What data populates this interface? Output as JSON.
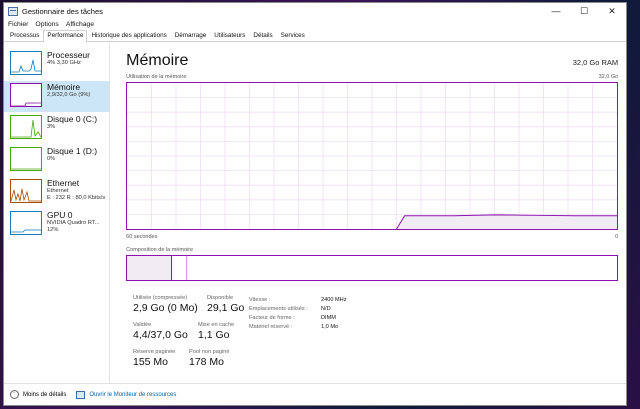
{
  "window": {
    "title": "Gestionnaire des tâches"
  },
  "menu": [
    "Fichier",
    "Options",
    "Affichage"
  ],
  "tabs": [
    "Processus",
    "Performance",
    "Historique des applications",
    "Démarrage",
    "Utilisateurs",
    "Détails",
    "Services"
  ],
  "active_tab": "Performance",
  "sidebar": [
    {
      "name": "Processeur",
      "line1": "4% 3,30 GHz",
      "line2": "",
      "line3": "",
      "color": "#117dbb",
      "icon": "cpu-graph-icon"
    },
    {
      "name": "Mémoire",
      "line1": "2,9/32,0 Go (9%)",
      "line2": "",
      "line3": "",
      "color": "#8b12ae",
      "icon": "memory-graph-icon"
    },
    {
      "name": "Disque 0 (C:)",
      "line1": "3%",
      "line2": "",
      "line3": "",
      "color": "#4da60c",
      "icon": "disk-graph-icon"
    },
    {
      "name": "Disque 1 (D:)",
      "line1": "0%",
      "line2": "",
      "line3": "",
      "color": "#4da60c",
      "icon": "disk-graph-icon"
    },
    {
      "name": "Ethernet",
      "line1": "Ethernet",
      "line2": "E : 232 R : 80,0 Kbits/s",
      "line3": "",
      "color": "#a74f01",
      "icon": "network-graph-icon"
    },
    {
      "name": "GPU 0",
      "line1": "NVIDIA Quadro RT...",
      "line2": "12%",
      "line3": "",
      "color": "#117dbb",
      "icon": "gpu-graph-icon"
    }
  ],
  "main": {
    "title": "Mémoire",
    "total": "32,0 Go RAM",
    "usage_label": "Utilisation de la mémoire",
    "usage_max": "32,0 Go",
    "time_span": "60 secondes",
    "time_zero": "0",
    "composition_label": "Composition de la mémoire"
  },
  "chart_data": {
    "type": "area",
    "title": "Utilisation de la mémoire",
    "xlabel": "60 secondes",
    "ylabel": "",
    "ylim": [
      0,
      32
    ],
    "xlim": [
      60,
      0
    ],
    "color": "#8b12ae",
    "x": [
      60,
      50,
      40,
      30,
      27,
      26,
      20,
      15,
      10,
      5,
      0
    ],
    "values": [
      null,
      null,
      null,
      null,
      0,
      2.9,
      2.9,
      3.1,
      3.0,
      2.9,
      2.9
    ]
  },
  "stats": {
    "utilisee_label": "Utilisée (compressée)",
    "utilisee_value": "2,9 Go (0 Mo)",
    "disponible_label": "Disponible",
    "disponible_value": "29,1 Go",
    "validee_label": "Validée",
    "validee_value": "4,4/37,0 Go",
    "cache_label": "Mise en cache",
    "cache_value": "1,1 Go",
    "paginee_label": "Réserve paginée",
    "paginee_value": "155 Mo",
    "nonpaginee_label": "Pool non paginé",
    "nonpaginee_value": "178 Mo"
  },
  "props": [
    {
      "k": "Vitesse :",
      "v": "2400 MHz"
    },
    {
      "k": "Emplacements utilisés :",
      "v": "N/D"
    },
    {
      "k": "Facteur de forme :",
      "v": "DIMM"
    },
    {
      "k": "Matériel réservé :",
      "v": "1,0 Mo"
    }
  ],
  "footer": {
    "less": "Moins de détails",
    "monitor": "Ouvrir le Moniteur de ressources"
  }
}
